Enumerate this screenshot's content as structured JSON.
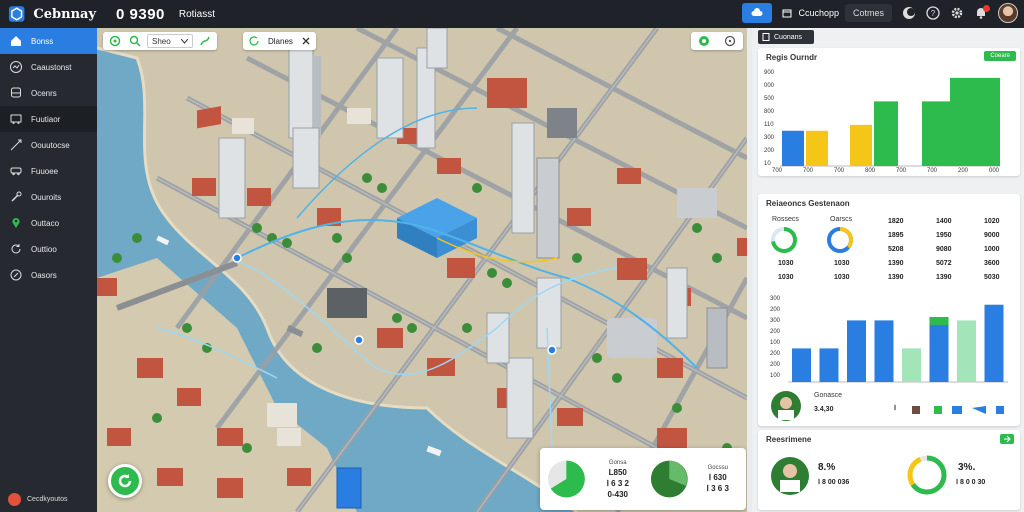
{
  "app": {
    "name": "Cebnnay",
    "clock": "0 9390",
    "subtitle": "Rotiasst",
    "search_label": "Ccuchopp",
    "search_placeholder": "Cotmes"
  },
  "sidebar": {
    "items": [
      {
        "label": "Bonss",
        "icon": "home-icon",
        "state": "active"
      },
      {
        "label": "Caaustonst",
        "icon": "chart-icon",
        "state": ""
      },
      {
        "label": "Ocenrs",
        "icon": "bus-icon",
        "state": ""
      },
      {
        "label": "Fuutiaor",
        "icon": "bus-icon",
        "state": "dark"
      },
      {
        "label": "Oouutocse",
        "icon": "route-icon",
        "state": ""
      },
      {
        "label": "Fuuoee",
        "icon": "vehicle-icon",
        "state": ""
      },
      {
        "label": "Ouuroits",
        "icon": "tools-icon",
        "state": ""
      },
      {
        "label": "Outtaco",
        "icon": "pin-icon",
        "state": ""
      },
      {
        "label": "Outtioo",
        "icon": "refresh-icon",
        "state": ""
      },
      {
        "label": "Oasors",
        "icon": "route-icon",
        "state": ""
      }
    ],
    "footer_label": "Cecdkyoutos"
  },
  "map": {
    "toolbar_select": "Sheo",
    "group_label": "Dlanes",
    "card": {
      "left_label": "Gonsa",
      "left_values": [
        "L850",
        "Ⅰ 6 3 2",
        "0-430"
      ],
      "right_label": "Gocssu",
      "right_values": [
        "Ⅰ 630",
        "Ⅰ 3 6 3"
      ]
    }
  },
  "panel": {
    "tab_label": "Cuonans",
    "chart1": {
      "title": "Regis Ourndr",
      "chip": "Coeare",
      "ytick_labels": [
        "900",
        "000",
        "500",
        "800",
        "110",
        "300",
        "200",
        "10"
      ],
      "xtick_labels": [
        "700",
        "700",
        "700",
        "800",
        "700",
        "700",
        "200",
        "000"
      ]
    },
    "stats": {
      "title": "Reiaeoncs Gestenaon",
      "col_labels": [
        "Rossecs",
        "Oarscs"
      ],
      "left_values": [
        "1030",
        "1030"
      ],
      "rows": [
        [
          "1820",
          "1400",
          "1020"
        ],
        [
          "1895",
          "1950",
          "9000"
        ],
        [
          "5208",
          "9080",
          "1000"
        ],
        [
          "1390",
          "5072",
          "3600"
        ],
        [
          "1390",
          "1390",
          "5030"
        ]
      ]
    },
    "chart2": {
      "ytick_labels": [
        "300",
        "200",
        "300",
        "200",
        "100",
        "200",
        "200",
        "100"
      ],
      "footer_label": "Gonasce",
      "footer_value": "3.4,30",
      "footer_mid": "Ⅰ"
    },
    "bottom": {
      "title": "Reesrimene",
      "pct_left": "8.%",
      "value_left": "Ⅰ 8 00 036",
      "pct_right": "3%.",
      "value_right": "Ⅰ 8 0 0 30"
    }
  },
  "chart_data": [
    {
      "type": "bar",
      "title": "Regis Ourndr",
      "series": [
        {
          "values": [
            3,
            3,
            3.5,
            5.5,
            5.5,
            7.5,
            7.5
          ]
        }
      ],
      "colors": [
        "#2a7de1",
        "#f5c518",
        "#f5c518",
        "#2dbb4e",
        "#2dbb4e",
        "#2dbb4e",
        "#2dbb4e"
      ]
    },
    {
      "type": "bar",
      "series": [
        {
          "values": [
            3,
            3,
            5.5,
            5.5,
            3,
            5.8,
            5.5,
            6.9
          ]
        }
      ],
      "colors": [
        "#2a7de1",
        "#2a7de1",
        "#2a7de1",
        "#2a7de1",
        "#a3e4b8",
        "#2a7de1",
        "#a3e4b8",
        "#2a7de1"
      ]
    }
  ]
}
